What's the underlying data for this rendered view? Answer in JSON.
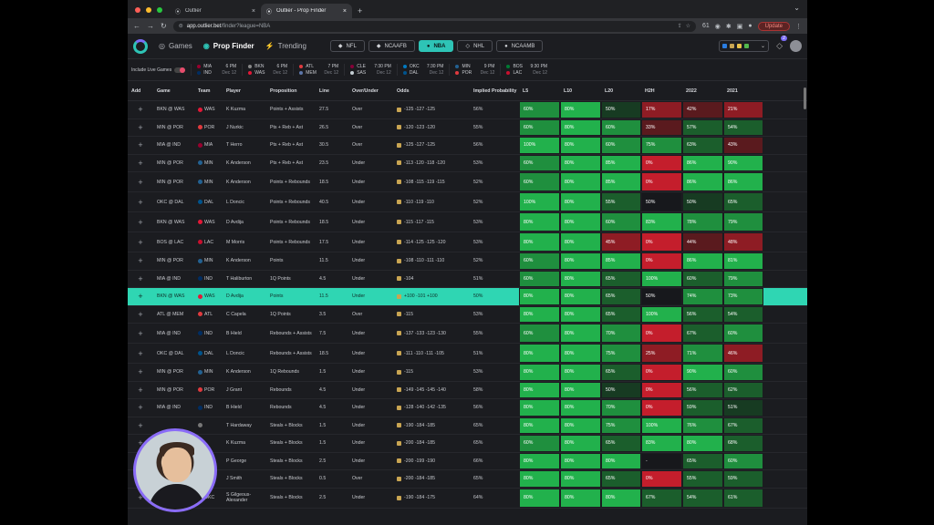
{
  "browser": {
    "tabs": [
      {
        "title": "Outlier"
      },
      {
        "title": "Outlier - Prop Finder"
      }
    ],
    "url_host": "app.outlier.bet",
    "url_path": "/finder?league=NBA",
    "ext_count": "61",
    "update_label": "Update"
  },
  "header": {
    "nav": [
      {
        "label": "Games"
      },
      {
        "label": "Prop Finder"
      },
      {
        "label": "Trending"
      }
    ],
    "sports": [
      {
        "label": "NFL"
      },
      {
        "label": "NCAAFB"
      },
      {
        "label": "NBA"
      },
      {
        "label": "NHL"
      },
      {
        "label": "NCAAMB"
      }
    ],
    "notif_badge": "2"
  },
  "games_strip": {
    "live_label": "Include Live Games",
    "games": [
      {
        "a": "MIA",
        "b": "IND",
        "time": "6 PM",
        "date": "Dec 12"
      },
      {
        "a": "BKN",
        "b": "WAS",
        "time": "6 PM",
        "date": "Dec 12"
      },
      {
        "a": "ATL",
        "b": "MEM",
        "time": "7 PM",
        "date": "Dec 12"
      },
      {
        "a": "CLE",
        "b": "SAS",
        "time": "7:30 PM",
        "date": "Dec 12"
      },
      {
        "a": "OKC",
        "b": "DAL",
        "time": "7:30 PM",
        "date": "Dec 12"
      },
      {
        "a": "MIN",
        "b": "POR",
        "time": "9 PM",
        "date": "Dec 12"
      },
      {
        "a": "BOS",
        "b": "LAC",
        "time": "9:30 PM",
        "date": "Dec 12"
      }
    ]
  },
  "table": {
    "headers": [
      "Add",
      "Game",
      "Team",
      "Player",
      "Proposition",
      "Line",
      "Over/Under",
      "Odds",
      "Implied Probability",
      "L5",
      "L10",
      "L20",
      "H2H",
      "2022",
      "2021"
    ],
    "rows": [
      {
        "game": "BKN @ WAS",
        "team": "WAS",
        "player": "K Kuzma",
        "prop": "Points + Assists",
        "line": "27.5",
        "ou": "Over",
        "odds": "-125  -127  -125",
        "ip": "56%",
        "p": [
          "60%",
          "80%",
          "50%",
          "17%",
          "42%",
          "21%"
        ],
        "c": [
          "g3",
          "g4",
          "g1",
          "r3",
          "r2",
          "r3"
        ]
      },
      {
        "game": "MIN @ POR",
        "team": "POR",
        "player": "J Nurkic",
        "prop": "Pts + Reb + Ast",
        "line": "26.5",
        "ou": "Over",
        "odds": "-120  -123  -120",
        "ip": "55%",
        "p": [
          "60%",
          "80%",
          "60%",
          "33%",
          "57%",
          "54%"
        ],
        "c": [
          "g3",
          "g4",
          "g3",
          "r2",
          "g2",
          "g2"
        ]
      },
      {
        "game": "MIA @ IND",
        "team": "MIA",
        "player": "T Herro",
        "prop": "Pts + Reb + Ast",
        "line": "30.5",
        "ou": "Over",
        "odds": "-125  -127  -125",
        "ip": "56%",
        "p": [
          "100%",
          "80%",
          "60%",
          "75%",
          "63%",
          "43%"
        ],
        "c": [
          "g4",
          "g4",
          "g3",
          "g3",
          "g2",
          "r2"
        ]
      },
      {
        "game": "MIN @ POR",
        "team": "MIN",
        "player": "K Anderson",
        "prop": "Pts + Reb + Ast",
        "line": "23.5",
        "ou": "Under",
        "odds": "-113  -120  -118  -120",
        "ip": "53%",
        "p": [
          "60%",
          "80%",
          "85%",
          "0%",
          "86%",
          "90%"
        ],
        "c": [
          "g3",
          "g4",
          "g4",
          "r4",
          "g4",
          "g4"
        ]
      },
      {
        "game": "MIN @ POR",
        "team": "MIN",
        "player": "K Anderson",
        "prop": "Points + Rebounds",
        "line": "18.5",
        "ou": "Under",
        "odds": "-108  -115  -119  -115",
        "ip": "52%",
        "p": [
          "60%",
          "80%",
          "85%",
          "0%",
          "86%",
          "86%"
        ],
        "c": [
          "g3",
          "g4",
          "g4",
          "r4",
          "g4",
          "g4"
        ],
        "tall": true
      },
      {
        "game": "OKC @ DAL",
        "team": "DAL",
        "player": "L Doncic",
        "prop": "Points + Rebounds",
        "line": "40.5",
        "ou": "Under",
        "odds": "-110  -119  -110",
        "ip": "52%",
        "p": [
          "100%",
          "80%",
          "55%",
          "50%",
          "50%",
          "65%"
        ],
        "c": [
          "g4",
          "g4",
          "g2",
          "nx",
          "g1",
          "g2"
        ],
        "tall": true
      },
      {
        "game": "BKN @ WAS",
        "team": "WAS",
        "player": "D Avdija",
        "prop": "Points + Rebounds",
        "line": "18.5",
        "ou": "Under",
        "odds": "-115  -117  -115",
        "ip": "53%",
        "p": [
          "80%",
          "80%",
          "60%",
          "83%",
          "78%",
          "79%"
        ],
        "c": [
          "g4",
          "g4",
          "g3",
          "g4",
          "g3",
          "g3"
        ],
        "tall": true
      },
      {
        "game": "BOS @ LAC",
        "team": "LAC",
        "player": "M Morris",
        "prop": "Points + Rebounds",
        "line": "17.5",
        "ou": "Under",
        "odds": "-114  -125  -125  -120",
        "ip": "53%",
        "p": [
          "80%",
          "80%",
          "45%",
          "0%",
          "44%",
          "48%"
        ],
        "c": [
          "g4",
          "g4",
          "r3",
          "r4",
          "r2",
          "r3"
        ],
        "tall": true
      },
      {
        "game": "MIN @ POR",
        "team": "MIN",
        "player": "K Anderson",
        "prop": "Points",
        "line": "11.5",
        "ou": "Under",
        "odds": "-108  -110  -111  -110",
        "ip": "52%",
        "p": [
          "60%",
          "80%",
          "85%",
          "0%",
          "86%",
          "81%"
        ],
        "c": [
          "g3",
          "g4",
          "g4",
          "r4",
          "g4",
          "g4"
        ]
      },
      {
        "game": "MIA @ IND",
        "team": "IND",
        "player": "T Haliburton",
        "prop": "1Q Points",
        "line": "4.5",
        "ou": "Under",
        "odds": "-104",
        "ip": "51%",
        "p": [
          "60%",
          "80%",
          "65%",
          "100%",
          "60%",
          "79%"
        ],
        "c": [
          "g3",
          "g4",
          "g2",
          "g4",
          "g2",
          "g3"
        ]
      },
      {
        "game": "BKN @ WAS",
        "team": "WAS",
        "player": "D Avdija",
        "prop": "Points",
        "line": "11.5",
        "ou": "Under",
        "odds": "+100  -101  +100",
        "ip": "50%",
        "p": [
          "80%",
          "80%",
          "65%",
          "50%",
          "74%",
          "73%"
        ],
        "c": [
          "g4",
          "g4",
          "g2",
          "nx",
          "g3",
          "g3"
        ],
        "hl": true
      },
      {
        "game": "ATL @ MEM",
        "team": "ATL",
        "player": "C Capela",
        "prop": "1Q Points",
        "line": "3.5",
        "ou": "Over",
        "odds": "-115",
        "ip": "53%",
        "p": [
          "80%",
          "80%",
          "65%",
          "100%",
          "56%",
          "54%"
        ],
        "c": [
          "g4",
          "g4",
          "g2",
          "g4",
          "g2",
          "g2"
        ]
      },
      {
        "game": "MIA @ IND",
        "team": "IND",
        "player": "B Hield",
        "prop": "Rebounds + Assists",
        "line": "7.5",
        "ou": "Under",
        "odds": "-137  -133  -123  -130",
        "ip": "55%",
        "p": [
          "60%",
          "80%",
          "70%",
          "0%",
          "67%",
          "60%"
        ],
        "c": [
          "g3",
          "g4",
          "g3",
          "r4",
          "g2",
          "g3"
        ],
        "tall": true
      },
      {
        "game": "OKC @ DAL",
        "team": "DAL",
        "player": "L Doncic",
        "prop": "Rebounds + Assists",
        "line": "18.5",
        "ou": "Under",
        "odds": "-111  -110  -111  -105",
        "ip": "51%",
        "p": [
          "80%",
          "80%",
          "75%",
          "25%",
          "71%",
          "46%"
        ],
        "c": [
          "g4",
          "g4",
          "g3",
          "r3",
          "g3",
          "r3"
        ],
        "tall": true
      },
      {
        "game": "MIN @ POR",
        "team": "MIN",
        "player": "K Anderson",
        "prop": "1Q Rebounds",
        "line": "1.5",
        "ou": "Under",
        "odds": "-115",
        "ip": "53%",
        "p": [
          "80%",
          "80%",
          "65%",
          "0%",
          "90%",
          "60%"
        ],
        "c": [
          "g4",
          "g4",
          "g2",
          "r4",
          "g4",
          "g3"
        ]
      },
      {
        "game": "MIN @ POR",
        "team": "POR",
        "player": "J Grant",
        "prop": "Rebounds",
        "line": "4.5",
        "ou": "Under",
        "odds": "-149  -145  -145  -140",
        "ip": "58%",
        "p": [
          "80%",
          "80%",
          "50%",
          "0%",
          "56%",
          "62%"
        ],
        "c": [
          "g4",
          "g4",
          "g1",
          "r4",
          "g2",
          "g2"
        ]
      },
      {
        "game": "MIA @ IND",
        "team": "IND",
        "player": "B Hield",
        "prop": "Rebounds",
        "line": "4.5",
        "ou": "Under",
        "odds": "-128  -140  -142  -135",
        "ip": "56%",
        "p": [
          "80%",
          "80%",
          "70%",
          "0%",
          "59%",
          "51%"
        ],
        "c": [
          "g4",
          "g4",
          "g3",
          "r4",
          "g2",
          "g1"
        ]
      },
      {
        "game": "",
        "team": "",
        "player": "T Hardaway",
        "prop": "Steals + Blocks",
        "line": "1.5",
        "ou": "Under",
        "odds": "-190  -184  -185",
        "ip": "65%",
        "p": [
          "80%",
          "80%",
          "75%",
          "100%",
          "76%",
          "67%"
        ],
        "c": [
          "g4",
          "g4",
          "g3",
          "g4",
          "g3",
          "g2"
        ]
      },
      {
        "game": "",
        "team": "",
        "player": "K Kuzma",
        "prop": "Steals + Blocks",
        "line": "1.5",
        "ou": "Under",
        "odds": "-200  -184  -185",
        "ip": "65%",
        "p": [
          "60%",
          "80%",
          "65%",
          "83%",
          "80%",
          "68%"
        ],
        "c": [
          "g3",
          "g4",
          "g2",
          "g4",
          "g4",
          "g2"
        ]
      },
      {
        "game": "",
        "team": "",
        "player": "P George",
        "prop": "Steals + Blocks",
        "line": "2.5",
        "ou": "Under",
        "odds": "-200  -199  -190",
        "ip": "66%",
        "p": [
          "80%",
          "80%",
          "80%",
          "-",
          "65%",
          "60%"
        ],
        "c": [
          "g4",
          "g4",
          "g4",
          "nx",
          "g2",
          "g3"
        ]
      },
      {
        "game": "",
        "team": "",
        "player": "J Smith",
        "prop": "Steals + Blocks",
        "line": "0.5",
        "ou": "Over",
        "odds": "-200  -184  -185",
        "ip": "65%",
        "p": [
          "80%",
          "80%",
          "65%",
          "0%",
          "55%",
          "59%"
        ],
        "c": [
          "g4",
          "g4",
          "g2",
          "r4",
          "g2",
          "g2"
        ]
      },
      {
        "game": "",
        "team": "OKC",
        "player": "S Gilgeous-Alexander",
        "prop": "Steals + Blocks",
        "line": "2.5",
        "ou": "Under",
        "odds": "-190  -184  -175",
        "ip": "64%",
        "p": [
          "80%",
          "80%",
          "80%",
          "67%",
          "54%",
          "61%"
        ],
        "c": [
          "g4",
          "g4",
          "g4",
          "g2",
          "g2",
          "g2"
        ],
        "tall": true
      }
    ]
  },
  "colors": {
    "accent": "#2ec4b6",
    "highlight": "#2fd6b3",
    "purple": "#7b6cf6"
  }
}
